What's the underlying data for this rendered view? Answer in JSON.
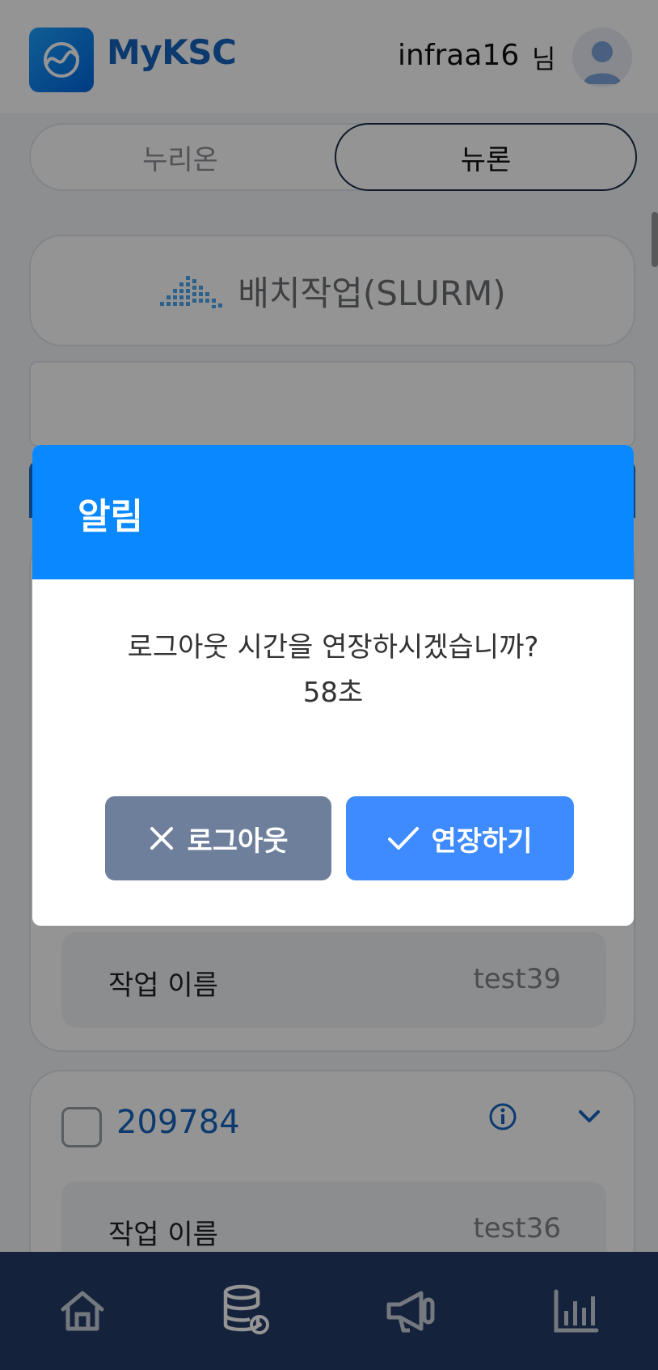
{
  "header": {
    "brand": "MyKSC",
    "user_name": "infraa16",
    "user_suffix": "님"
  },
  "tabs": [
    {
      "label": "누리온",
      "active": false
    },
    {
      "label": "뉴론",
      "active": true
    }
  ],
  "batch": {
    "title": "배치작업(SLURM)"
  },
  "jobs": [
    {
      "id": "",
      "field_label": "작업 이름",
      "field_value": "test39"
    },
    {
      "id": "209784",
      "field_label": "작업 이름",
      "field_value": "test36"
    }
  ],
  "bottom_nav": [
    {
      "icon": "home-icon"
    },
    {
      "icon": "database-settings-icon"
    },
    {
      "icon": "megaphone-icon"
    },
    {
      "icon": "bar-chart-icon"
    }
  ],
  "modal": {
    "title": "알림",
    "message": "로그아웃 시간을 연장하시겠습니까?",
    "countdown": "58초",
    "logout_label": "로그아웃",
    "extend_label": "연장하기"
  },
  "colors": {
    "brand_blue": "#1565c0",
    "modal_header": "#0a88ff",
    "extend_button": "#3d8bff",
    "logout_button": "#6e7f9c",
    "nav_bg": "#253c66"
  }
}
